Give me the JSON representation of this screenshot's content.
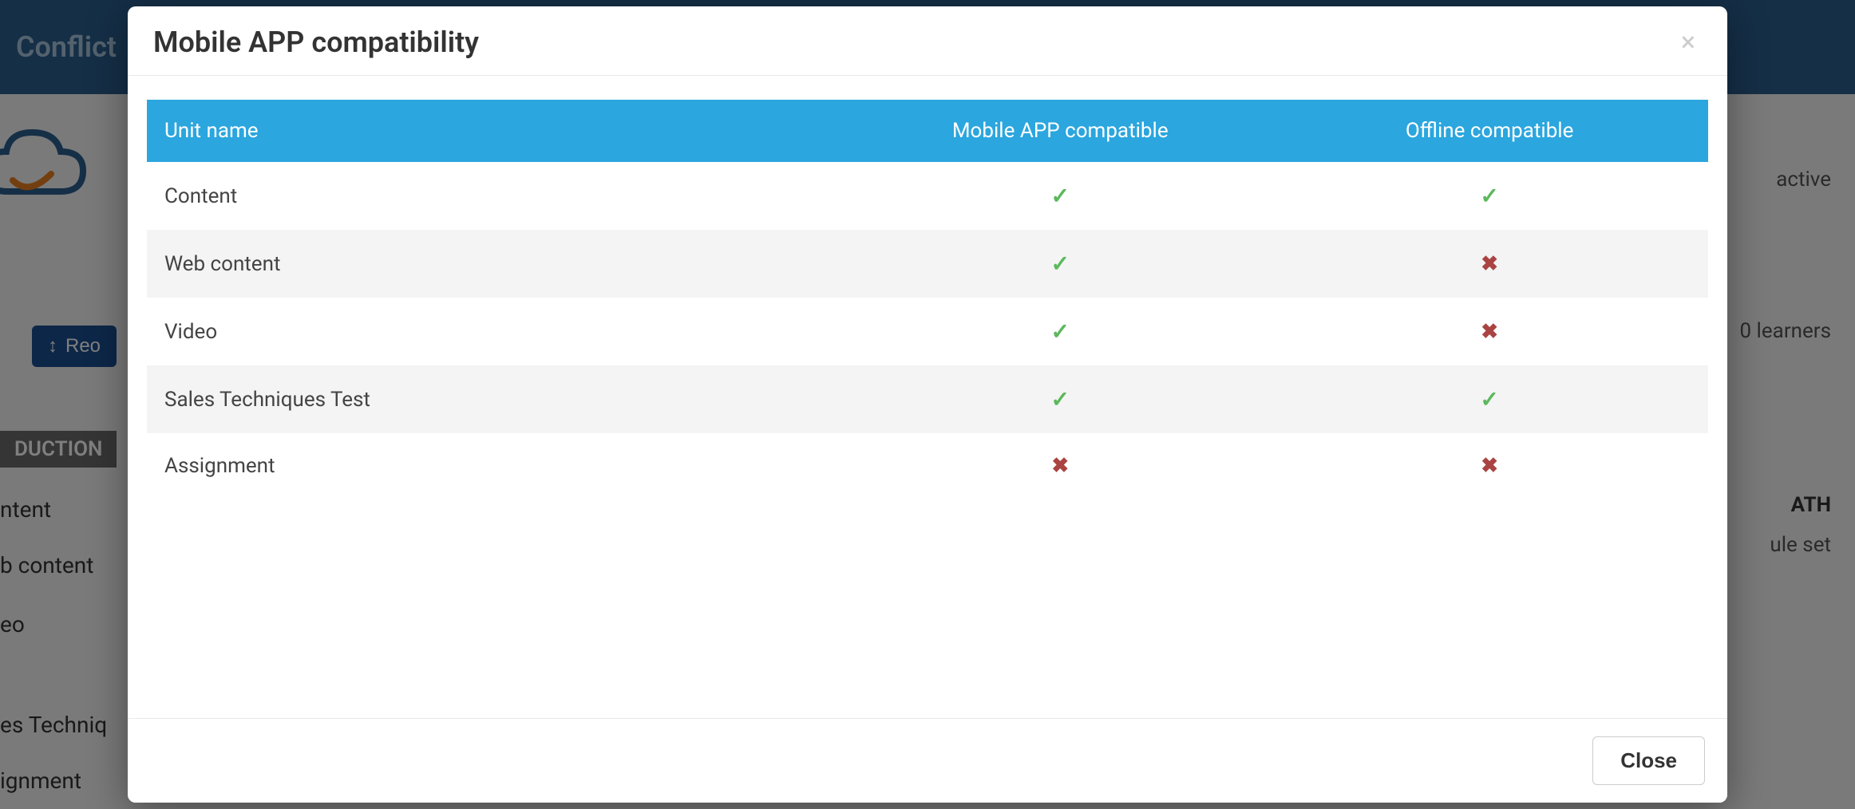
{
  "background": {
    "header_title": "Conflict",
    "reorder_label": "Reo",
    "section_label": "DUCTION",
    "items": [
      "ntent",
      "b content",
      "eo",
      "es Techniq",
      "ignment"
    ],
    "right": {
      "status": "active",
      "learners_line": "0 learners",
      "path_line": "ATH",
      "rule_line": "ule set"
    }
  },
  "modal": {
    "title": "Mobile APP compatibility",
    "close_label": "Close",
    "columns": {
      "unit_name": "Unit name",
      "mobile_compatible": "Mobile APP compatible",
      "offline_compatible": "Offline compatible"
    },
    "rows": [
      {
        "name": "Content",
        "mobile": true,
        "offline": true
      },
      {
        "name": "Web content",
        "mobile": true,
        "offline": false
      },
      {
        "name": "Video",
        "mobile": true,
        "offline": false
      },
      {
        "name": "Sales Techniques Test",
        "mobile": true,
        "offline": true
      },
      {
        "name": "Assignment",
        "mobile": false,
        "offline": false
      }
    ]
  }
}
